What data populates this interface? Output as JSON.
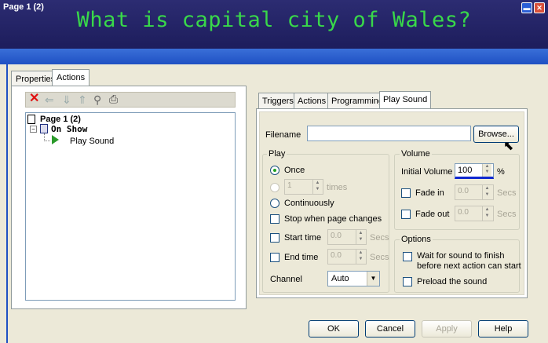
{
  "banner": {
    "title": "What is capital city of Wales?"
  },
  "window": {
    "title": "Page 1 (2)"
  },
  "left_tabs": [
    "Properties",
    "Actions"
  ],
  "tree": {
    "root": "Page 1 (2)",
    "event": "On Show",
    "action": "Play Sound"
  },
  "right_tabs": [
    "Triggers",
    "Actions",
    "Programming",
    "Play Sound"
  ],
  "filename": {
    "label": "Filename",
    "value": "",
    "browse": "Browse..."
  },
  "play": {
    "legend": "Play",
    "once": "Once",
    "times_value": "1",
    "times": "times",
    "continuously": "Continuously",
    "stop_when": "Stop when page changes",
    "start_time": "Start time",
    "start_value": "0.0",
    "end_time": "End time",
    "end_value": "0.0",
    "secs": "Secs",
    "channel": "Channel",
    "channel_value": "Auto"
  },
  "volume": {
    "legend": "Volume",
    "initial": "Initial Volume",
    "initial_value": "100",
    "percent": "%",
    "fade_in": "Fade in",
    "fade_in_value": "0.0",
    "fade_out": "Fade out",
    "fade_out_value": "0.0",
    "secs": "Secs"
  },
  "options": {
    "legend": "Options",
    "wait": "Wait for sound to finish",
    "wait2": "before next action can start",
    "preload": "Preload the sound"
  },
  "buttons": {
    "ok": "OK",
    "cancel": "Cancel",
    "apply": "Apply",
    "help": "Help"
  },
  "colors": {
    "banner": "#1d1d5c",
    "banner_text": "#39d84a",
    "titlebar": "#1f51c3"
  }
}
